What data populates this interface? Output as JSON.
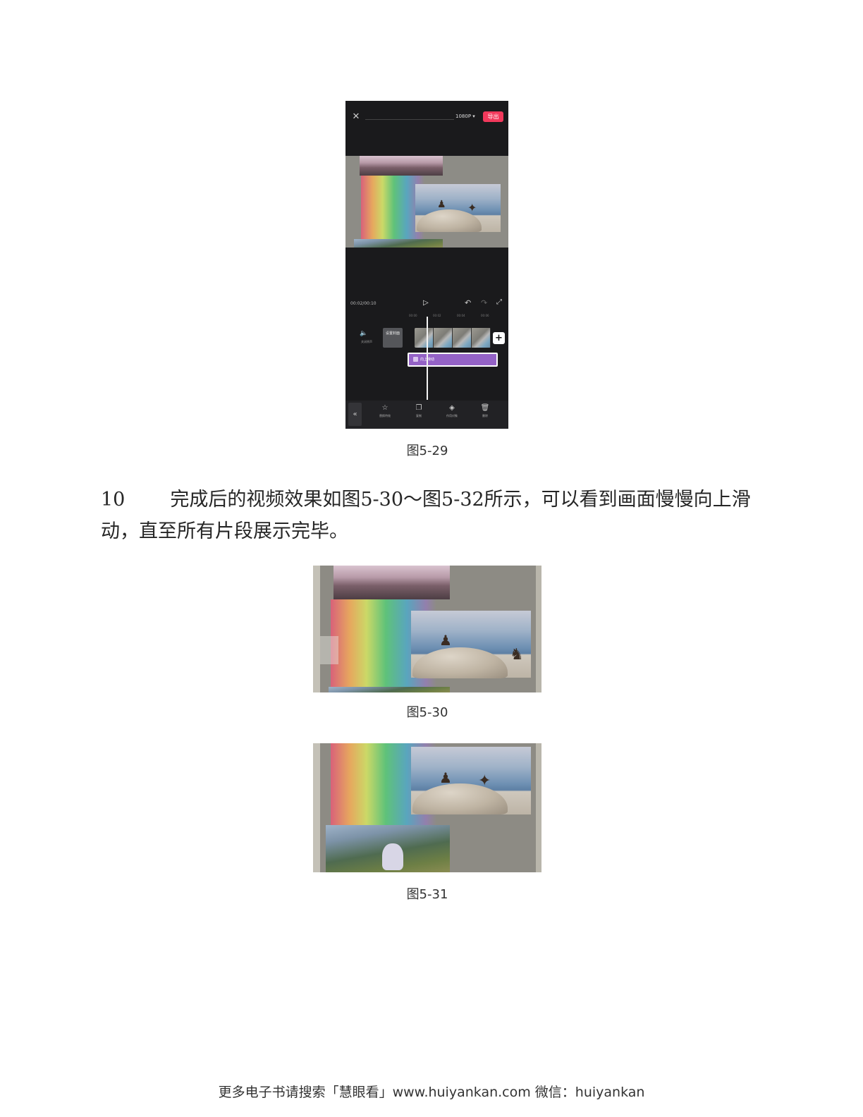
{
  "phone_screenshot": {
    "resolution": "1080P",
    "export_label": "导出",
    "timecode": "00:02/00:10",
    "ruler_ticks": [
      "00:00",
      "00:02",
      "00:04",
      "00:06"
    ],
    "mute_label": "关闭原声",
    "cover_label": "设置封面",
    "effect_track_label": "向上滑动",
    "toolbar": [
      {
        "icon": "replace-icon",
        "label": "替换特效"
      },
      {
        "icon": "copy-icon",
        "label": "复制"
      },
      {
        "icon": "layers-icon",
        "label": "作用对象"
      },
      {
        "icon": "delete-icon",
        "label": "删除"
      }
    ]
  },
  "captions": {
    "fig_5_29": "图5-29",
    "fig_5_30": "图5-30",
    "fig_5_31": "图5-31"
  },
  "step": {
    "number": "10",
    "text": "完成后的视频效果如图5-30～图5-32所示，可以看到画面慢慢向上滑动，直至所有片段展示完毕。"
  },
  "footer": "更多电子书请搜索「慧眼看」www.huiyankan.com  微信：huiyankan"
}
